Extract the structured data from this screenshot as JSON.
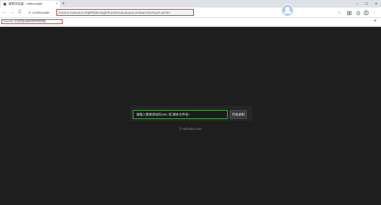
{
  "tab": {
    "title": "录制浏览器 - UIRecorder",
    "close": "×",
    "new_tab": "+"
  },
  "window_controls": {
    "minimize": "–",
    "maximize": "☐",
    "close": "✕"
  },
  "toolbar": {
    "back": "←",
    "forward": "→",
    "reload": "C",
    "extension_label": "UI Recorder",
    "url": "chrome-extension://hjkfhfldkecbpjlhfmmlnhmdcakopmcnn/start.html?port=53787",
    "star": "☆",
    "menu": "⋮"
  },
  "infobar": {
    "message": "\"Chrome\"正受到自动测试软件的控制。",
    "close": "✕"
  },
  "main": {
    "url_placeholder": "请输入需要测试的URL 或 脚本文件名!",
    "start_button": "开始录制",
    "brand": "© alibaba.com"
  },
  "colors": {
    "content_bg": "#1e1e1e",
    "input_border": "#45b649",
    "highlight_border": "#d93025"
  },
  "icons": {
    "back": "back-arrow-icon",
    "forward": "forward-arrow-icon",
    "reload": "reload-icon",
    "extension": "ui-recorder-icon",
    "bookmark": "star-icon",
    "extensions_area": "extension-icon",
    "account": "avatar-icon",
    "menu": "kebab-menu-icon"
  }
}
